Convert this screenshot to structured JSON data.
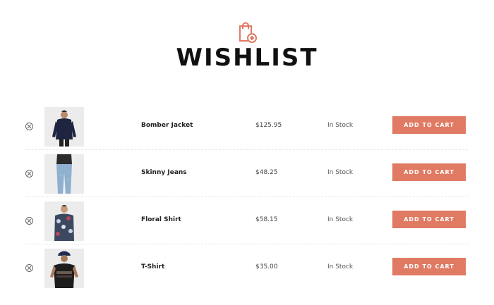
{
  "header": {
    "icon": "shopping-bag-plus-icon",
    "title": "WISHLIST",
    "accent": "#e07a62"
  },
  "items": [
    {
      "name": "Bomber Jacket",
      "price": "$125.95",
      "stock": "In Stock",
      "cta": "ADD TO CART"
    },
    {
      "name": "Skinny Jeans",
      "price": "$48.25",
      "stock": "In Stock",
      "cta": "ADD TO CART"
    },
    {
      "name": "Floral Shirt",
      "price": "$58.15",
      "stock": "In Stock",
      "cta": "ADD TO CART"
    },
    {
      "name": "T-Shirt",
      "price": "$35.00",
      "stock": "In Stock",
      "cta": "ADD TO CART"
    }
  ]
}
